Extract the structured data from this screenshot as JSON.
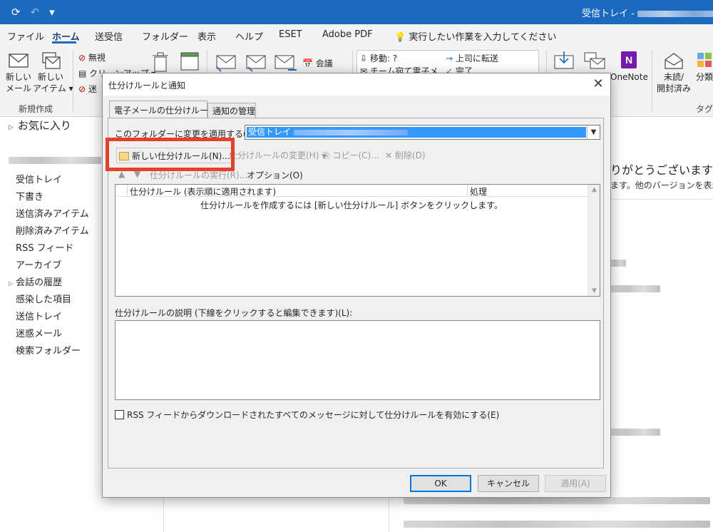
{
  "window": {
    "title": "受信トレイ - ",
    "qat": {
      "sync_icon": "⟳",
      "undo_icon": "↶",
      "customize_icon": "▾"
    }
  },
  "menu": {
    "tabs": [
      "ファイル",
      "ホーム",
      "送受信",
      "フォルダー",
      "表示",
      "ヘルプ",
      "ESET",
      "Adobe PDF"
    ],
    "tell_me": "実行したい作業を入力してください"
  },
  "ribbon": {
    "new_mail": "新しい\nメール",
    "new_items": "新しい\nアイテム ▾",
    "group_new": "新規作成",
    "ignore": "無視",
    "cleanup": "クリーンアップ ▾",
    "junk": "迷",
    "meeting": "会議",
    "qs_move": "移動: ?",
    "qs_manager": "上司に転送",
    "qs_team": "チーム宛て電子メ...",
    "qs_done": "完了",
    "onenote": "OneNote",
    "unread_read": "未読/\n開封済み",
    "categorize": "分類",
    "group_tags": "タグ"
  },
  "folders": {
    "favorites": "お気に入り",
    "items": [
      "受信トレイ",
      "下書き",
      "送信済みアイテム",
      "削除済みアイテム",
      "RSS フィード",
      "アーカイブ",
      "会話の履歴",
      "感染した項目",
      "送信トレイ",
      "迷惑メール",
      "検索フォルダー"
    ]
  },
  "reading": {
    "thanks": "りがとうございます！",
    "versions": "ます。他のバージョンを表示する"
  },
  "dialog": {
    "title": "仕分けルールと通知",
    "close": "✕",
    "tab_email_rules": "電子メールの仕分けルール",
    "tab_manage_alerts": "通知の管理",
    "apply_label": "このフォルダーに変更を適用する(F):",
    "folder_value": "受信トレイ",
    "new_rule": "新しい仕分けルール(N)...",
    "change_rule": "仕分けルールの変更(H)",
    "copy": "コピー(C)...",
    "delete": "削除(D)",
    "run_rules": "仕分けルールの実行(R)...",
    "options": "オプション(O)",
    "col_rule": "仕分けルール (表示順に適用されます)",
    "col_action": "処理",
    "empty_message": "仕分けルールを作成するには [新しい仕分けルール] ボタンをクリックします。",
    "description_label": "仕分けルールの説明 (下線をクリックすると編集できます)(L):",
    "rss_checkbox": "RSS フィードからダウンロードされたすべてのメッセージに対して仕分けルールを有効にする(E)",
    "ok": "OK",
    "cancel": "キャンセル",
    "apply": "適用(A)"
  },
  "colors": {
    "accent": "#1b6ac0",
    "highlight_box": "#e2412b",
    "selection": "#3399ff"
  }
}
